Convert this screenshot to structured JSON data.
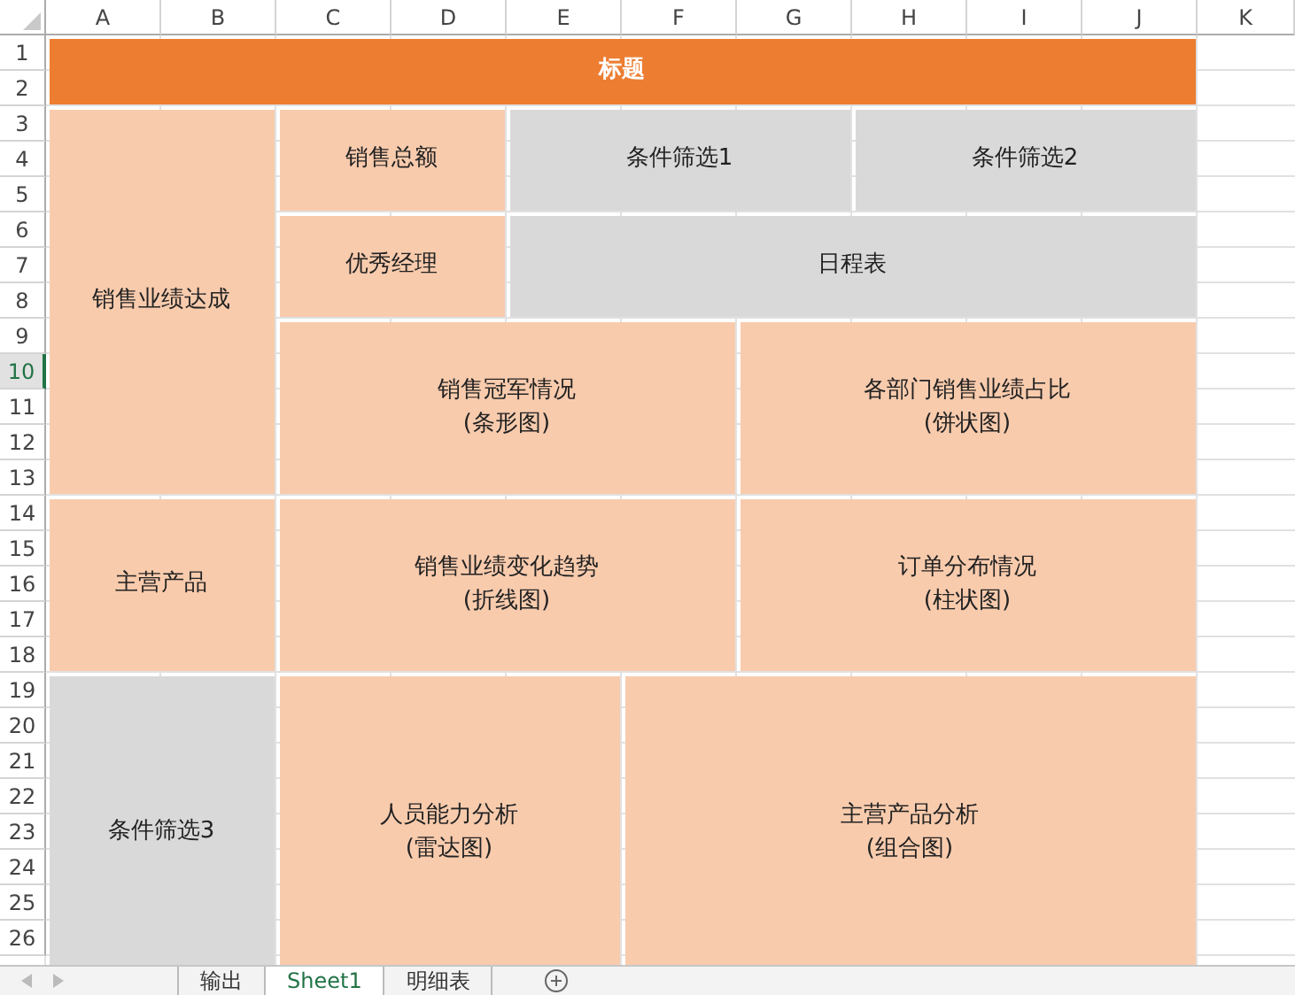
{
  "columns": [
    {
      "label": "A"
    },
    {
      "label": "B"
    },
    {
      "label": "C"
    },
    {
      "label": "D"
    },
    {
      "label": "E"
    },
    {
      "label": "F"
    },
    {
      "label": "G"
    },
    {
      "label": "H"
    },
    {
      "label": "I"
    },
    {
      "label": "J"
    },
    {
      "label": "K"
    }
  ],
  "rows": [
    {
      "label": "1",
      "selected": false
    },
    {
      "label": "2",
      "selected": false
    },
    {
      "label": "3",
      "selected": false
    },
    {
      "label": "4",
      "selected": false
    },
    {
      "label": "5",
      "selected": false
    },
    {
      "label": "6",
      "selected": false
    },
    {
      "label": "7",
      "selected": false
    },
    {
      "label": "8",
      "selected": false
    },
    {
      "label": "9",
      "selected": false
    },
    {
      "label": "10",
      "selected": true
    },
    {
      "label": "11",
      "selected": false
    },
    {
      "label": "12",
      "selected": false
    },
    {
      "label": "13",
      "selected": false
    },
    {
      "label": "14",
      "selected": false
    },
    {
      "label": "15",
      "selected": false
    },
    {
      "label": "16",
      "selected": false
    },
    {
      "label": "17",
      "selected": false
    },
    {
      "label": "18",
      "selected": false
    },
    {
      "label": "19",
      "selected": false
    },
    {
      "label": "20",
      "selected": false
    },
    {
      "label": "21",
      "selected": false
    },
    {
      "label": "22",
      "selected": false
    },
    {
      "label": "23",
      "selected": false
    },
    {
      "label": "24",
      "selected": false
    },
    {
      "label": "25",
      "selected": false
    },
    {
      "label": "26",
      "selected": false
    }
  ],
  "blocks": [
    {
      "kind": "banner",
      "title": "标题",
      "color": "#ed7d31"
    },
    {
      "kind": "panel",
      "title": "销售业绩达成",
      "color": "#f8cbad"
    },
    {
      "kind": "panel",
      "title": "销售总额",
      "color": "#f8cbad"
    },
    {
      "kind": "panel",
      "title": "条件筛选1",
      "color": "#d9d9d9"
    },
    {
      "kind": "panel",
      "title": "条件筛选2",
      "color": "#d9d9d9"
    },
    {
      "kind": "panel",
      "title": "优秀经理",
      "color": "#f8cbad"
    },
    {
      "kind": "panel",
      "title": "日程表",
      "color": "#d9d9d9"
    },
    {
      "kind": "panel",
      "title": "销售冠军情况",
      "subtitle": "(条形图)",
      "color": "#f8cbad"
    },
    {
      "kind": "panel",
      "title": "各部门销售业绩占比",
      "subtitle": "(饼状图)",
      "color": "#f8cbad"
    },
    {
      "kind": "panel",
      "title": "主营产品",
      "color": "#f8cbad"
    },
    {
      "kind": "panel",
      "title": "销售业绩变化趋势",
      "subtitle": "(折线图)",
      "color": "#f8cbad"
    },
    {
      "kind": "panel",
      "title": "订单分布情况",
      "subtitle": "(柱状图)",
      "color": "#f8cbad"
    },
    {
      "kind": "panel",
      "title": "条件筛选3",
      "color": "#d9d9d9"
    },
    {
      "kind": "panel",
      "title": "人员能力分析",
      "subtitle": "(雷达图)",
      "color": "#f8cbad"
    },
    {
      "kind": "panel",
      "title": "主营产品分析",
      "subtitle": "(组合图)",
      "color": "#f8cbad"
    }
  ],
  "sheet_tabs": [
    {
      "label": "输出",
      "selected": false
    },
    {
      "label": "Sheet1",
      "selected": true
    },
    {
      "label": "明细表",
      "selected": false
    }
  ]
}
